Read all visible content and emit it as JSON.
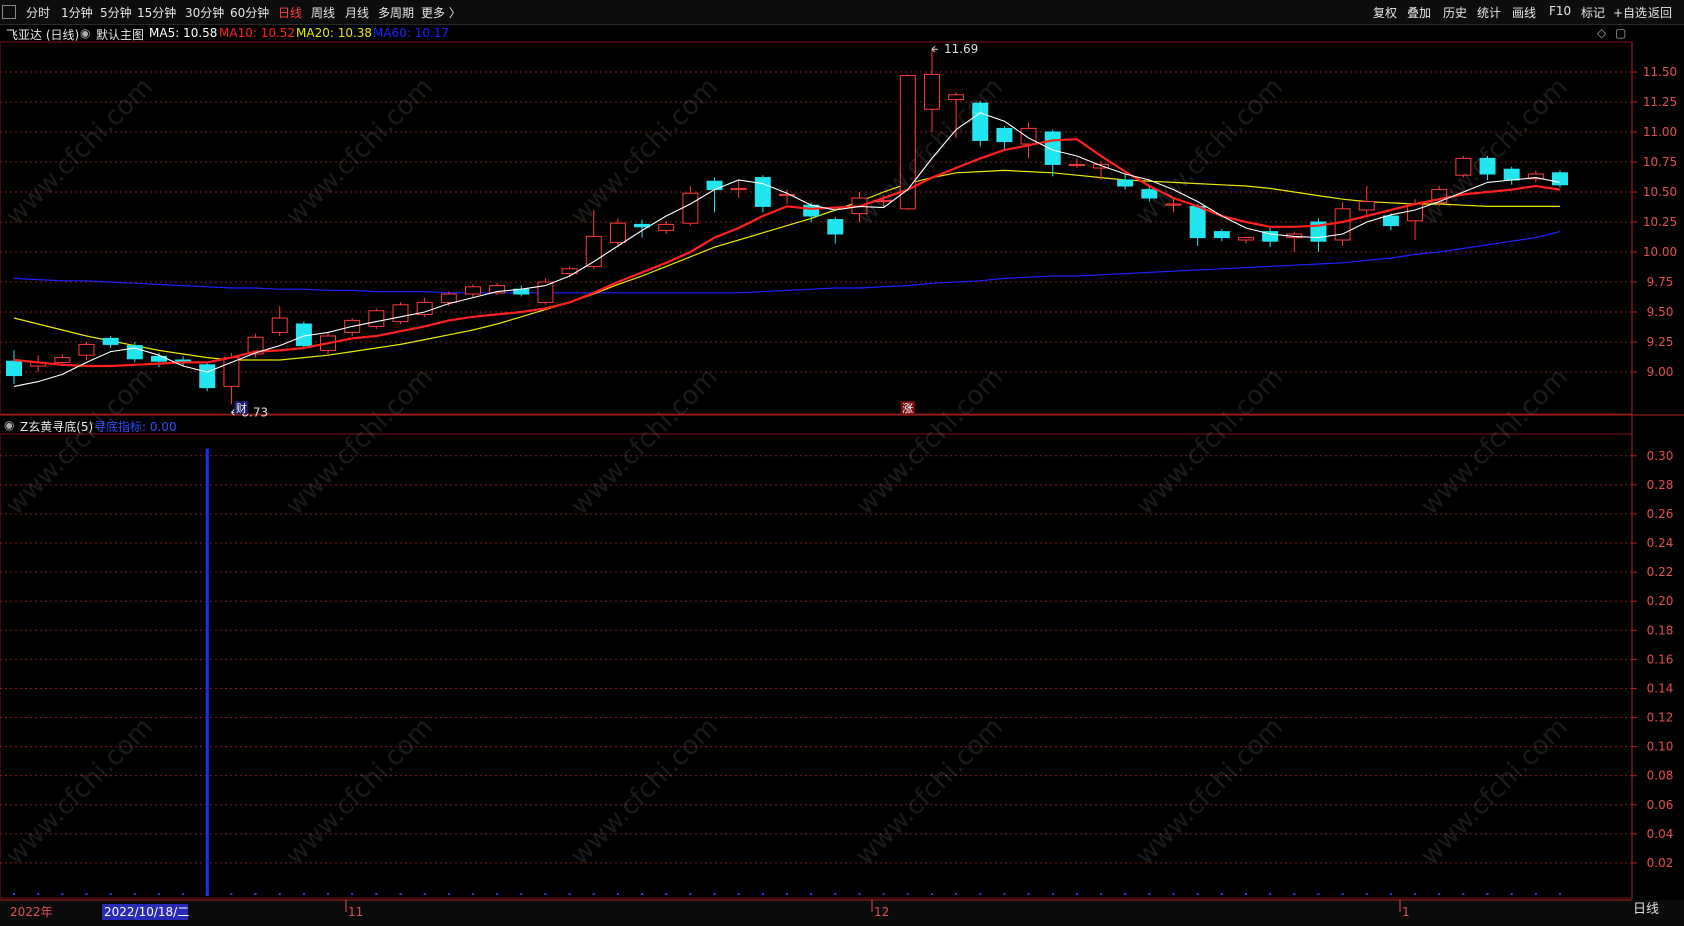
{
  "toolbar": {
    "periods": [
      "分时",
      "1分钟",
      "5分钟",
      "15分钟",
      "30分钟",
      "60分钟",
      "日线",
      "周线",
      "月线",
      "多周期",
      "更多 〉"
    ],
    "active_period": "日线",
    "tools": [
      "复权",
      "叠加",
      "历史",
      "统计",
      "画线",
      "F10",
      "标记",
      "+自选",
      "返回"
    ]
  },
  "main_panel": {
    "stock_name": "飞亚达 (日线)",
    "template": "默认主图",
    "ma_labels": [
      {
        "text": "MA5: 10.58",
        "color": "#ffffff"
      },
      {
        "text": "MA10: 10.52",
        "color": "#ff2020"
      },
      {
        "text": "MA20: 10.38",
        "color": "#e8e800"
      },
      {
        "text": "MA60: 10.17",
        "color": "#2020ff"
      }
    ],
    "y_ticks": [
      "11.50",
      "11.25",
      "11.00",
      "10.75",
      "10.50",
      "10.25",
      "10.00",
      "9.75",
      "9.50",
      "9.25",
      "9.00"
    ],
    "high_label": "11.69",
    "low_label": "8.73",
    "marker_cai": "财",
    "marker_zhang": "涨"
  },
  "indicator_panel": {
    "name": "Z玄黄寻底(5)",
    "value_label": "寻底指标: 0.00",
    "y_ticks": [
      "0.30",
      "0.28",
      "0.26",
      "0.24",
      "0.22",
      "0.20",
      "0.18",
      "0.16",
      "0.14",
      "0.12",
      "0.10",
      "0.08",
      "0.06",
      "0.04",
      "0.02"
    ]
  },
  "time_axis": {
    "year_label": "2022年",
    "cursor_date": "2022/10/18/二",
    "month_labels": [
      "11",
      "12",
      "1"
    ]
  },
  "side_label": "日线",
  "watermark": "www.cfchi.com",
  "colors": {
    "up": "#ff3b3b",
    "down": "#22e6ef",
    "ma5": "#ffffff",
    "ma10": "#ff2020",
    "ma20": "#e8e800",
    "ma60": "#2020ff",
    "grid": "#8b1a1a"
  },
  "chart_data": {
    "type": "candlestick",
    "candles": [
      [
        9.09,
        8.97,
        9.18,
        8.9
      ],
      [
        9.05,
        9.08,
        9.14,
        9.0
      ],
      [
        9.08,
        9.12,
        9.15,
        9.05
      ],
      [
        9.14,
        9.23,
        9.25,
        9.1
      ],
      [
        9.28,
        9.23,
        9.3,
        9.2
      ],
      [
        9.22,
        9.11,
        9.25,
        9.08
      ],
      [
        9.13,
        9.09,
        9.16,
        9.04
      ],
      [
        9.1,
        9.08,
        9.13,
        9.05
      ],
      [
        9.06,
        8.87,
        9.08,
        8.84
      ],
      [
        8.88,
        9.12,
        9.16,
        8.73
      ],
      [
        9.15,
        9.29,
        9.32,
        9.12
      ],
      [
        9.33,
        9.45,
        9.55,
        9.3
      ],
      [
        9.4,
        9.22,
        9.42,
        9.19
      ],
      [
        9.18,
        9.3,
        9.33,
        9.15
      ],
      [
        9.33,
        9.43,
        9.45,
        9.3
      ],
      [
        9.38,
        9.51,
        9.53,
        9.36
      ],
      [
        9.42,
        9.56,
        9.58,
        9.4
      ],
      [
        9.48,
        9.58,
        9.62,
        9.46
      ],
      [
        9.58,
        9.65,
        9.67,
        9.55
      ],
      [
        9.65,
        9.71,
        9.73,
        9.62
      ],
      [
        9.66,
        9.72,
        9.74,
        9.64
      ],
      [
        9.69,
        9.65,
        9.72,
        9.63
      ],
      [
        9.58,
        9.75,
        9.78,
        9.56
      ],
      [
        9.82,
        9.86,
        9.88,
        9.79
      ],
      [
        9.88,
        10.13,
        10.35,
        9.86
      ],
      [
        10.08,
        10.24,
        10.28,
        10.05
      ],
      [
        10.23,
        10.21,
        10.27,
        10.12
      ],
      [
        10.18,
        10.23,
        10.26,
        10.15
      ],
      [
        10.24,
        10.49,
        10.55,
        10.22
      ],
      [
        10.59,
        10.52,
        10.62,
        10.33
      ],
      [
        10.53,
        10.53,
        10.6,
        10.45
      ],
      [
        10.62,
        10.38,
        10.64,
        10.33
      ],
      [
        10.48,
        10.48,
        10.52,
        10.4
      ],
      [
        10.39,
        10.3,
        10.41,
        10.25
      ],
      [
        10.27,
        10.15,
        10.29,
        10.07
      ],
      [
        10.32,
        10.45,
        10.5,
        10.25
      ],
      [
        10.43,
        10.43,
        10.47,
        10.37
      ],
      [
        10.36,
        11.47,
        11.48,
        10.35
      ],
      [
        11.19,
        11.48,
        11.69,
        11.0
      ],
      [
        11.27,
        11.31,
        11.33,
        10.95
      ],
      [
        11.24,
        10.93,
        11.26,
        10.88
      ],
      [
        11.03,
        10.92,
        11.05,
        10.85
      ],
      [
        10.9,
        11.03,
        11.08,
        10.78
      ],
      [
        11.0,
        10.73,
        11.02,
        10.63
      ],
      [
        10.73,
        10.73,
        10.78,
        10.7
      ],
      [
        10.7,
        10.73,
        10.76,
        10.6
      ],
      [
        10.6,
        10.55,
        10.65,
        10.52
      ],
      [
        10.52,
        10.45,
        10.56,
        10.42
      ],
      [
        10.4,
        10.4,
        10.45,
        10.33
      ],
      [
        10.38,
        10.12,
        10.4,
        10.05
      ],
      [
        10.17,
        10.12,
        10.19,
        10.09
      ],
      [
        10.1,
        10.12,
        10.13,
        10.07
      ],
      [
        10.17,
        10.09,
        10.2,
        10.04
      ],
      [
        10.12,
        10.15,
        10.17,
        10.0
      ],
      [
        10.25,
        10.09,
        10.28,
        10.0
      ],
      [
        10.1,
        10.36,
        10.42,
        10.05
      ],
      [
        10.35,
        10.42,
        10.55,
        10.3
      ],
      [
        10.3,
        10.22,
        10.32,
        10.18
      ],
      [
        10.26,
        10.4,
        10.44,
        10.1
      ],
      [
        10.41,
        10.52,
        10.55,
        10.38
      ],
      [
        10.64,
        10.78,
        10.8,
        10.62
      ],
      [
        10.78,
        10.65,
        10.8,
        10.6
      ],
      [
        10.69,
        10.6,
        10.71,
        10.56
      ],
      [
        10.61,
        10.65,
        10.68,
        10.58
      ],
      [
        10.66,
        10.56,
        10.68,
        10.54
      ]
    ],
    "ma5": [
      8.88,
      8.92,
      8.98,
      9.08,
      9.17,
      9.2,
      9.14,
      9.05,
      9.0,
      9.08,
      9.16,
      9.22,
      9.3,
      9.33,
      9.38,
      9.42,
      9.46,
      9.5,
      9.57,
      9.62,
      9.67,
      9.69,
      9.72,
      9.8,
      9.92,
      10.05,
      10.18,
      10.3,
      10.4,
      10.52,
      10.6,
      10.57,
      10.49,
      10.39,
      10.35,
      10.38,
      10.37,
      10.52,
      10.78,
      11.02,
      11.16,
      11.09,
      10.95,
      10.85,
      10.8,
      10.72,
      10.65,
      10.6,
      10.52,
      10.42,
      10.3,
      10.2,
      10.15,
      10.13,
      10.12,
      10.15,
      10.25,
      10.31,
      10.35,
      10.42,
      10.5,
      10.58,
      10.6,
      10.62,
      10.58
    ],
    "ma10": [
      9.1,
      9.08,
      9.06,
      9.05,
      9.05,
      9.06,
      9.07,
      9.08,
      9.08,
      9.12,
      9.17,
      9.18,
      9.2,
      9.24,
      9.28,
      9.3,
      9.34,
      9.38,
      9.43,
      9.46,
      9.48,
      9.5,
      9.53,
      9.58,
      9.66,
      9.75,
      9.83,
      9.91,
      10.0,
      10.12,
      10.2,
      10.3,
      10.38,
      10.36,
      10.37,
      10.38,
      10.45,
      10.52,
      10.62,
      10.7,
      10.78,
      10.85,
      10.89,
      10.93,
      10.94,
      10.8,
      10.67,
      10.55,
      10.45,
      10.38,
      10.3,
      10.25,
      10.21,
      10.21,
      10.22,
      10.25,
      10.3,
      10.35,
      10.4,
      10.44,
      10.48,
      10.5,
      10.52,
      10.55,
      10.52
    ],
    "ma20": [
      9.45,
      9.4,
      9.35,
      9.3,
      9.26,
      9.22,
      9.18,
      9.15,
      9.12,
      9.1,
      9.1,
      9.1,
      9.12,
      9.14,
      9.17,
      9.2,
      9.23,
      9.27,
      9.31,
      9.35,
      9.4,
      9.46,
      9.52,
      9.58,
      9.65,
      9.73,
      9.8,
      9.88,
      9.96,
      10.04,
      10.1,
      10.16,
      10.22,
      10.28,
      10.35,
      10.42,
      10.5,
      10.57,
      10.62,
      10.66,
      10.67,
      10.68,
      10.67,
      10.66,
      10.64,
      10.62,
      10.6,
      10.59,
      10.58,
      10.57,
      10.56,
      10.55,
      10.53,
      10.5,
      10.47,
      10.44,
      10.42,
      10.41,
      10.4,
      10.4,
      10.39,
      10.38,
      10.38,
      10.38,
      10.38
    ],
    "ma60": [
      9.78,
      9.77,
      9.76,
      9.76,
      9.75,
      9.74,
      9.73,
      9.72,
      9.71,
      9.7,
      9.7,
      9.69,
      9.69,
      9.68,
      9.68,
      9.67,
      9.67,
      9.67,
      9.66,
      9.66,
      9.66,
      9.66,
      9.66,
      9.66,
      9.66,
      9.66,
      9.66,
      9.66,
      9.66,
      9.66,
      9.66,
      9.67,
      9.68,
      9.69,
      9.7,
      9.7,
      9.71,
      9.72,
      9.74,
      9.75,
      9.76,
      9.78,
      9.79,
      9.8,
      9.8,
      9.81,
      9.82,
      9.83,
      9.84,
      9.85,
      9.86,
      9.87,
      9.88,
      9.89,
      9.9,
      9.91,
      9.93,
      9.95,
      9.98,
      10.0,
      10.03,
      10.06,
      10.09,
      10.12,
      10.17
    ],
    "indicator_spike": {
      "bar_index": 8,
      "value": 0.305
    }
  }
}
